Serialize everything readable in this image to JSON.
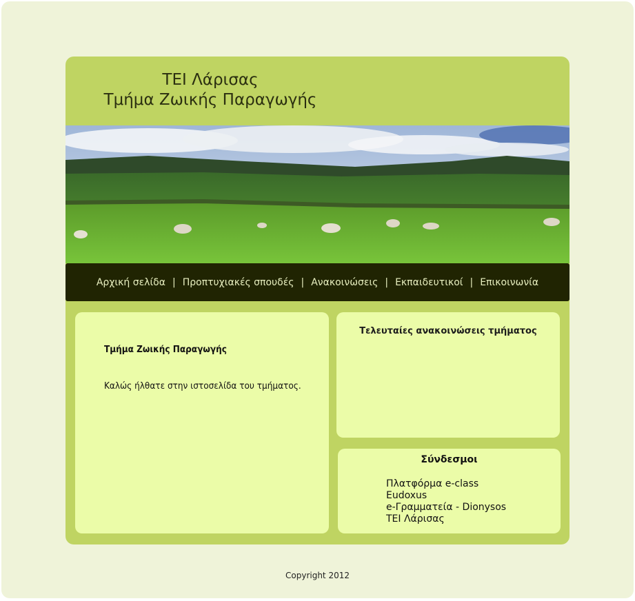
{
  "header": {
    "title_line1": "ΤΕΙ Λάρισας",
    "title_line2": "Τμήμα Ζωικής Παραγωγής"
  },
  "banner": {
    "icon": "pasture-landscape-image"
  },
  "nav": {
    "items": [
      {
        "label": "Αρχική σελίδα"
      },
      {
        "label": "Προπτυχιακές σπουδές"
      },
      {
        "label": "Ανακοινώσεις"
      },
      {
        "label": "Εκπαιδευτικοί"
      },
      {
        "label": "Επικοινωνία"
      }
    ],
    "separator": "|"
  },
  "main": {
    "heading": "Τμήμα Ζωικής Παραγωγής",
    "welcome": "Καλώς ήλθατε στην ιστοσελίδα του τμήματος."
  },
  "news": {
    "heading": "Τελευταίες ανακοινώσεις τμήματος"
  },
  "links": {
    "heading": "Σύνδεσμοι",
    "items": [
      {
        "label": "Πλατφόρμα e-class"
      },
      {
        "label": "Eudoxus"
      },
      {
        "label": "e-Γραμματεία - Dionysos"
      },
      {
        "label": "ΤΕΙ Λάρισας"
      }
    ]
  },
  "footer": {
    "copyright": "Copyright 2012"
  },
  "colors": {
    "outer_bg": "#eff3d9",
    "page_bg": "#bfd462",
    "nav_bg": "#202402",
    "panel_bg": "#ebfca8"
  }
}
